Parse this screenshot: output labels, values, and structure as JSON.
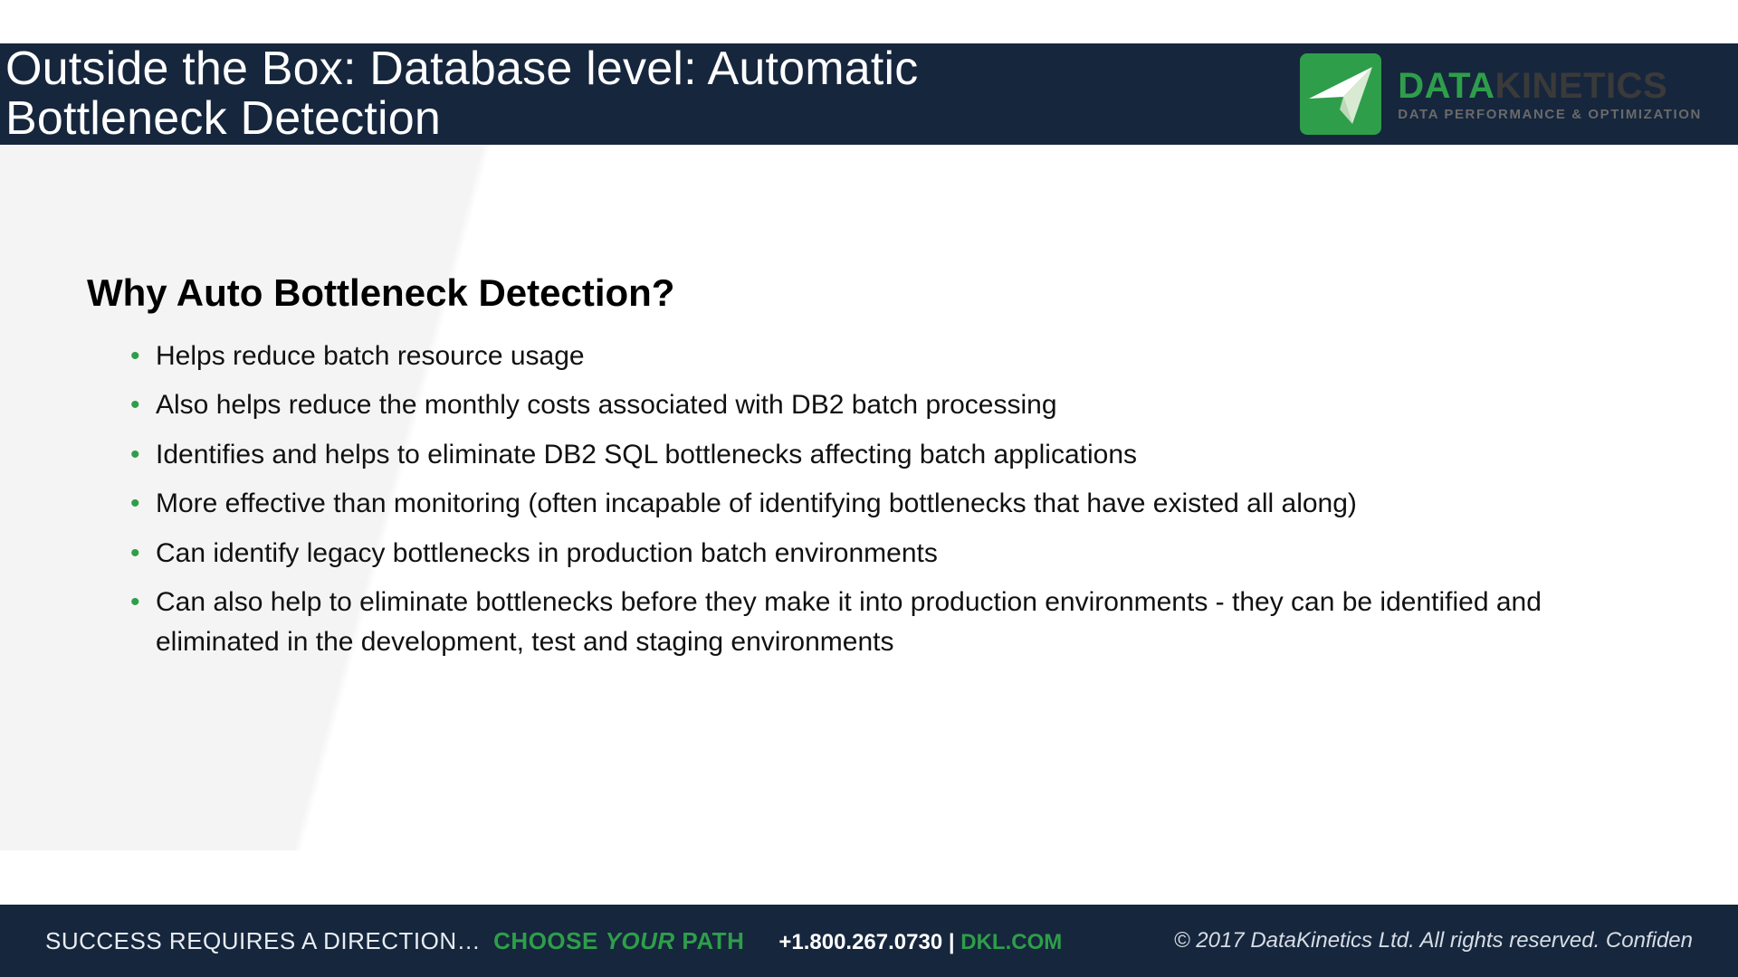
{
  "header": {
    "title": "Outside the Box: Database level: Automatic Bottleneck Detection"
  },
  "logo": {
    "word1": "DATA",
    "word2": "KINETICS",
    "tagline": "DATA PERFORMANCE & OPTIMIZATION"
  },
  "content": {
    "section_title": "Why Auto Bottleneck Detection?",
    "bullets": [
      "Helps reduce batch resource usage",
      "Also helps reduce the monthly costs associated with DB2 batch processing",
      "Identifies and helps to eliminate DB2 SQL bottlenecks affecting batch applications",
      "More effective than monitoring (often incapable of identifying bottlenecks that have existed all along)",
      "Can identify legacy bottlenecks in production batch environments",
      "Can also help to eliminate bottlenecks before they make it into production environments - they can be identified and eliminated in the development, test and staging environments"
    ]
  },
  "footer": {
    "tagline_a": "SUCCESS REQUIRES A DIRECTION…",
    "tagline_b_pre": "CHOOSE ",
    "tagline_b_your": "YOUR",
    "tagline_b_post": " PATH",
    "phone": "+1.800.267.0730",
    "sep": "  |  ",
    "site": "DKL.COM",
    "copyright": "© 2017 DataKinetics Ltd.   All rights reserved.  Confiden"
  }
}
